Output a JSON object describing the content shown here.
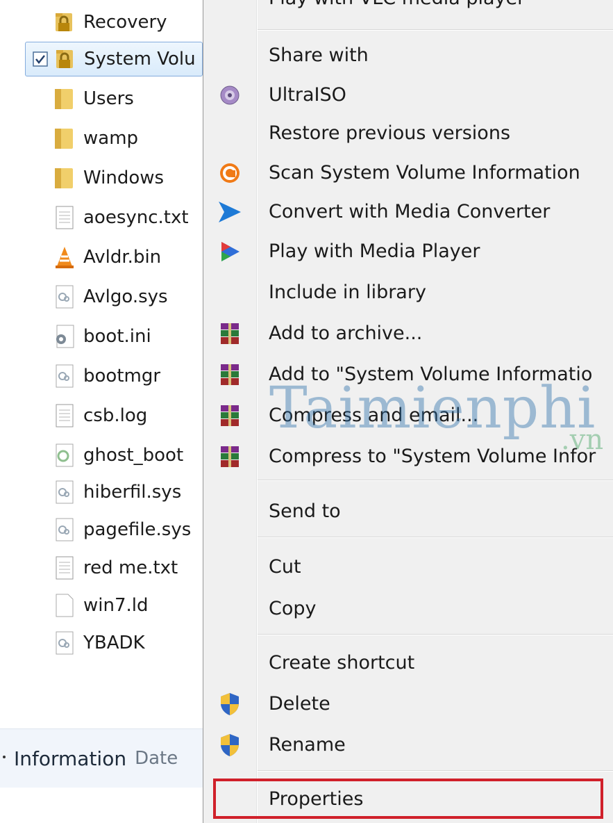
{
  "file_pane": {
    "items": [
      {
        "name": "Recovery",
        "icon": "lock-folder-icon"
      },
      {
        "name": "System Volu",
        "icon": "lock-folder-icon",
        "checked": true,
        "selected": true
      },
      {
        "name": "Users",
        "icon": "folder-icon"
      },
      {
        "name": "wamp",
        "icon": "folder-icon"
      },
      {
        "name": "Windows",
        "icon": "folder-icon"
      },
      {
        "name": "aoesync.txt",
        "icon": "text-file-icon"
      },
      {
        "name": "Avldr.bin",
        "icon": "vlc-cone-icon"
      },
      {
        "name": "Avlgo.sys",
        "icon": "system-file-icon"
      },
      {
        "name": "boot.ini",
        "icon": "settings-file-icon"
      },
      {
        "name": "bootmgr",
        "icon": "system-file-icon"
      },
      {
        "name": "csb.log",
        "icon": "text-file-icon"
      },
      {
        "name": "ghost_boot",
        "icon": "ghost-file-icon"
      },
      {
        "name": "hiberfil.sys",
        "icon": "system-file-icon"
      },
      {
        "name": "pagefile.sys",
        "icon": "system-file-icon"
      },
      {
        "name": "red me.txt",
        "icon": "text-file-icon"
      },
      {
        "name": "win7.ld",
        "icon": "blank-file-icon"
      },
      {
        "name": "YBADK",
        "icon": "system-file-icon"
      }
    ],
    "details_bar": {
      "label": "Information",
      "sub": "Date"
    }
  },
  "context_menu": {
    "partial_top_label": "Play with VLC media player",
    "items": [
      {
        "label": "Share with",
        "icon": ""
      },
      {
        "label": "UltraISO",
        "icon": "ultraiso-disc-icon"
      },
      {
        "label": "Restore previous versions",
        "icon": ""
      },
      {
        "label": "Scan System Volume Information",
        "icon": "avast-scan-icon"
      },
      {
        "label": "Convert with Media Converter",
        "icon": "media-converter-arrow-icon"
      },
      {
        "label": "Play with Media Player",
        "icon": "media-player-play-icon"
      },
      {
        "label": "Include in library",
        "icon": ""
      },
      {
        "label": "Add to archive...",
        "icon": "winrar-books-icon"
      },
      {
        "label": "Add to \"System Volume Informatio",
        "icon": "winrar-books-icon"
      },
      {
        "label": "Compress and email...",
        "icon": "winrar-books-icon"
      },
      {
        "label": "Compress to \"System Volume Infor",
        "icon": "winrar-books-icon"
      },
      {
        "label": "Send to",
        "icon": ""
      },
      {
        "label": "Cut",
        "icon": ""
      },
      {
        "label": "Copy",
        "icon": ""
      },
      {
        "label": "Create shortcut",
        "icon": ""
      },
      {
        "label": "Delete",
        "icon": "uac-shield-icon"
      },
      {
        "label": "Rename",
        "icon": "uac-shield-icon"
      },
      {
        "label": "Properties",
        "icon": "",
        "highlighted": true
      }
    ]
  },
  "watermark": {
    "main": "Taimienphi",
    "suffix": ".vn"
  },
  "colors": {
    "highlight_border": "#d0202a",
    "menu_background": "#f0f0f0",
    "selection_border": "#84acdd"
  }
}
